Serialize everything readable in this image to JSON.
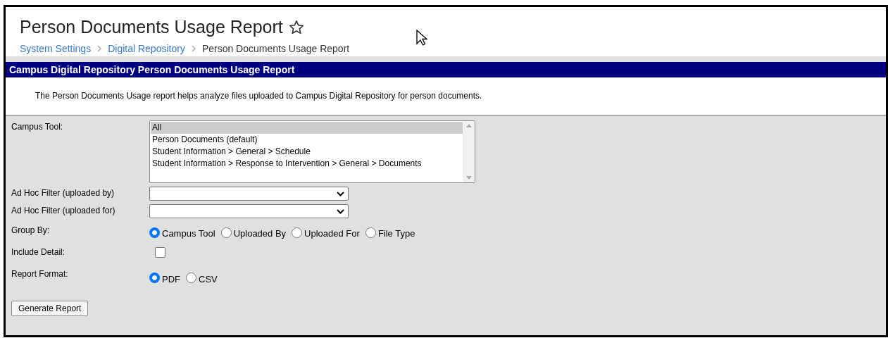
{
  "page": {
    "title": "Person Documents Usage Report",
    "favorite": false
  },
  "breadcrumbs": [
    {
      "label": "System Settings",
      "kind": "link"
    },
    {
      "label": "Digital Repository",
      "kind": "link"
    },
    {
      "label": "Person Documents Usage Report",
      "kind": "current"
    }
  ],
  "panel": {
    "title": "Campus Digital Repository Person Documents Usage Report",
    "description": "The Person Documents Usage report helps analyze files uploaded to Campus Digital Repository for person documents."
  },
  "form": {
    "campus_tool": {
      "label": "Campus Tool:",
      "options": [
        {
          "label": "All",
          "selected": true
        },
        {
          "label": "Person Documents (default)",
          "selected": false
        },
        {
          "label": "Student Information > General > Schedule",
          "selected": false
        },
        {
          "label": "Student Information > Response to Intervention > General > Documents",
          "selected": false
        }
      ]
    },
    "filters": [
      {
        "label": "Ad Hoc Filter (uploaded by)"
      },
      {
        "label": "Ad Hoc Filter (uploaded for)"
      }
    ],
    "group_by": {
      "label": "Group By:",
      "options": [
        {
          "label": "Campus Tool",
          "selected": true
        },
        {
          "label": "Uploaded By",
          "selected": false
        },
        {
          "label": "Uploaded For",
          "selected": false
        },
        {
          "label": "File Type",
          "selected": false
        }
      ]
    },
    "include_detail": {
      "label": "Include Detail:",
      "checked": false
    },
    "report_format": {
      "label": "Report Format:",
      "options": [
        {
          "label": "PDF",
          "selected": true
        },
        {
          "label": "CSV",
          "selected": false
        }
      ]
    },
    "submit": "Generate Report"
  }
}
